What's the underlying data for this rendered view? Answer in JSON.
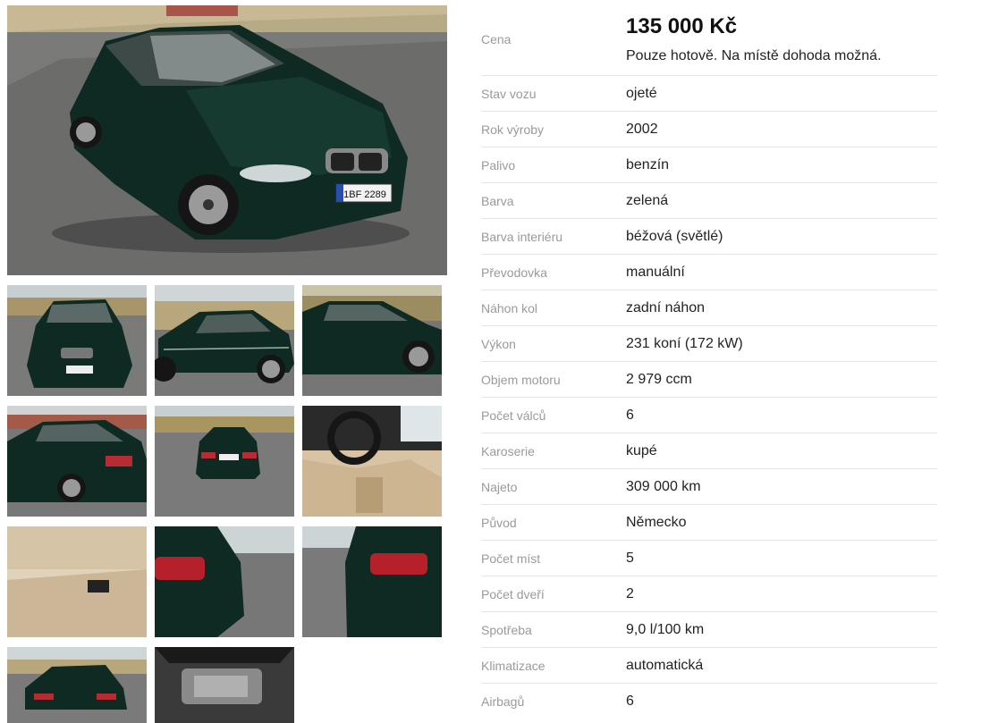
{
  "listing": {
    "price": "135 000 Kč",
    "price_note": "Pouze hotově. Na místě dohoda možná.",
    "price_label": "Cena",
    "specs": [
      {
        "label": "Stav vozu",
        "value": "ojeté"
      },
      {
        "label": "Rok výroby",
        "value": "2002"
      },
      {
        "label": "Palivo",
        "value": "benzín"
      },
      {
        "label": "Barva",
        "value": "zelená"
      },
      {
        "label": "Barva interiéru",
        "value": "béžová (světlé)"
      },
      {
        "label": "Převodovka",
        "value": "manuální"
      },
      {
        "label": "Náhon kol",
        "value": "zadní náhon"
      },
      {
        "label": "Výkon",
        "value": "231 koní (172 kW)"
      },
      {
        "label": "Objem motoru",
        "value": "2 979 ccm"
      },
      {
        "label": "Počet válců",
        "value": "6"
      },
      {
        "label": "Karoserie",
        "value": "kupé"
      },
      {
        "label": "Najeto",
        "value": "309 000 km"
      },
      {
        "label": "Původ",
        "value": "Německo"
      },
      {
        "label": "Počet míst",
        "value": "5"
      },
      {
        "label": "Počet dveří",
        "value": "2"
      },
      {
        "label": "Spotřeba",
        "value": "9,0 l/100 km"
      },
      {
        "label": "Klimatizace",
        "value": "automatická"
      },
      {
        "label": "Airbagů",
        "value": "6"
      }
    ]
  },
  "photos": {
    "plate_text": "1BF 2289",
    "colors": {
      "car": "#0f2a22",
      "road": "#6f6f6f",
      "sky": "#cfd8dc",
      "grass": "#9c8c62",
      "interior": "#d8c4a4"
    }
  }
}
